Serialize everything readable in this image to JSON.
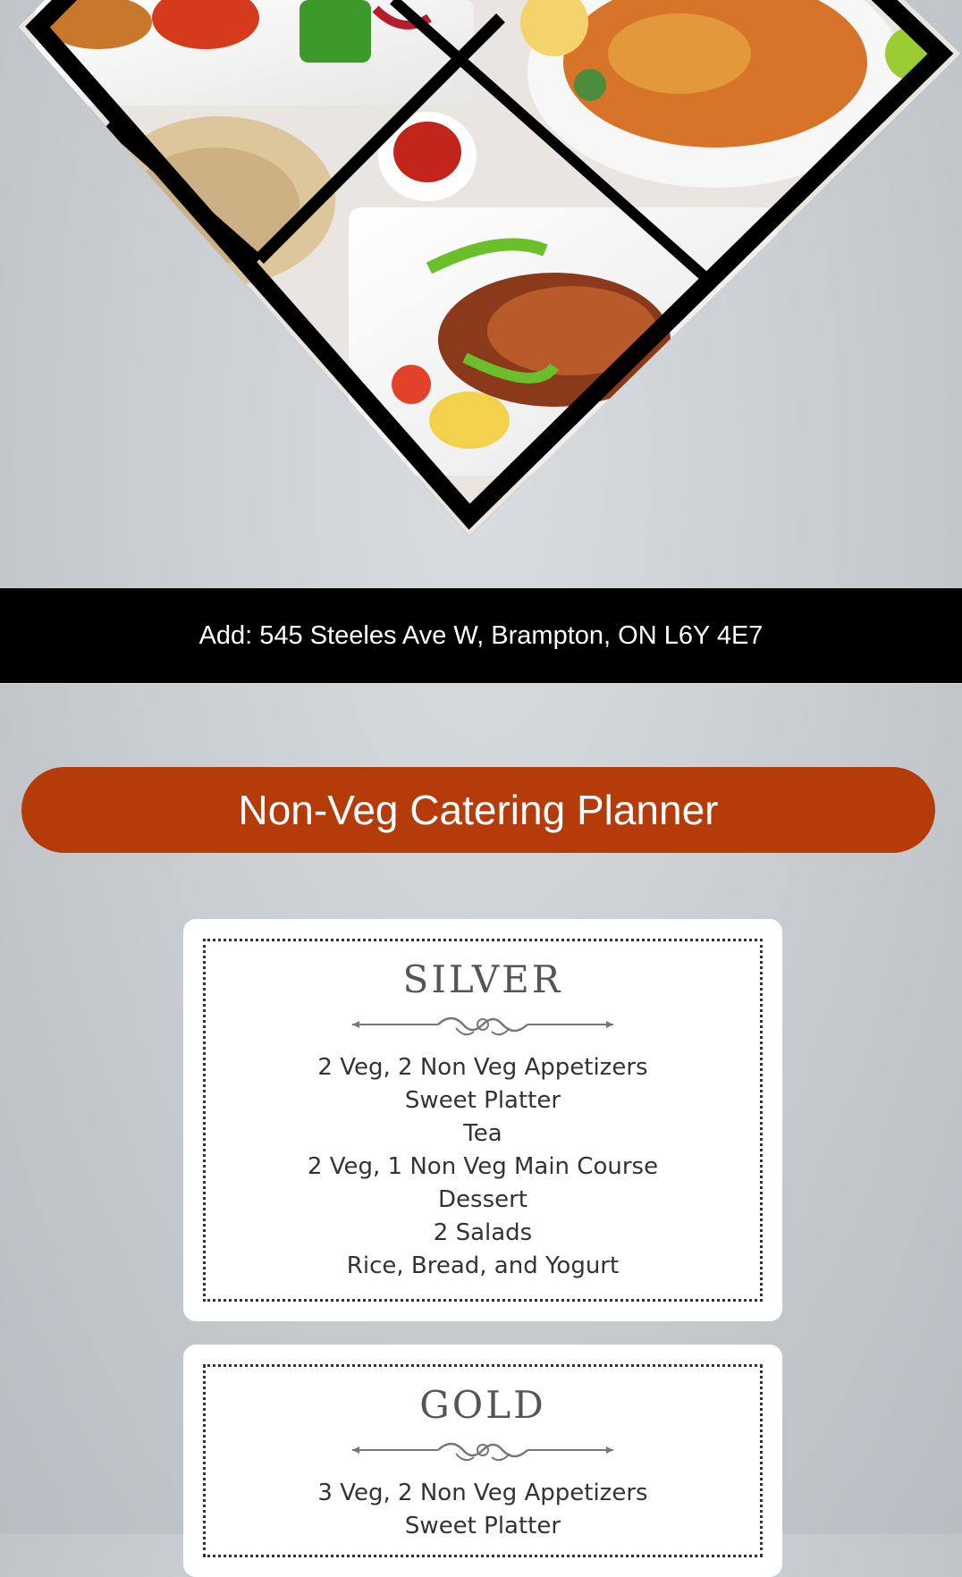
{
  "address": "Add: 545 Steeles Ave W, Brampton, ON L6Y 4E7",
  "planner_title": "Non-Veg Catering Planner",
  "packages": [
    {
      "tier": "SILVER",
      "items": [
        "2 Veg, 2 Non Veg Appetizers",
        "Sweet Platter",
        "Tea",
        "2 Veg, 1 Non Veg Main Course",
        "Dessert",
        "2 Salads",
        "Rice, Bread, and Yogurt"
      ]
    },
    {
      "tier": "GOLD",
      "items": [
        "3 Veg, 2 Non Veg Appetizers",
        "Sweet Platter"
      ]
    }
  ],
  "colors": {
    "accent": "#b53b0b",
    "bar": "#000000"
  }
}
